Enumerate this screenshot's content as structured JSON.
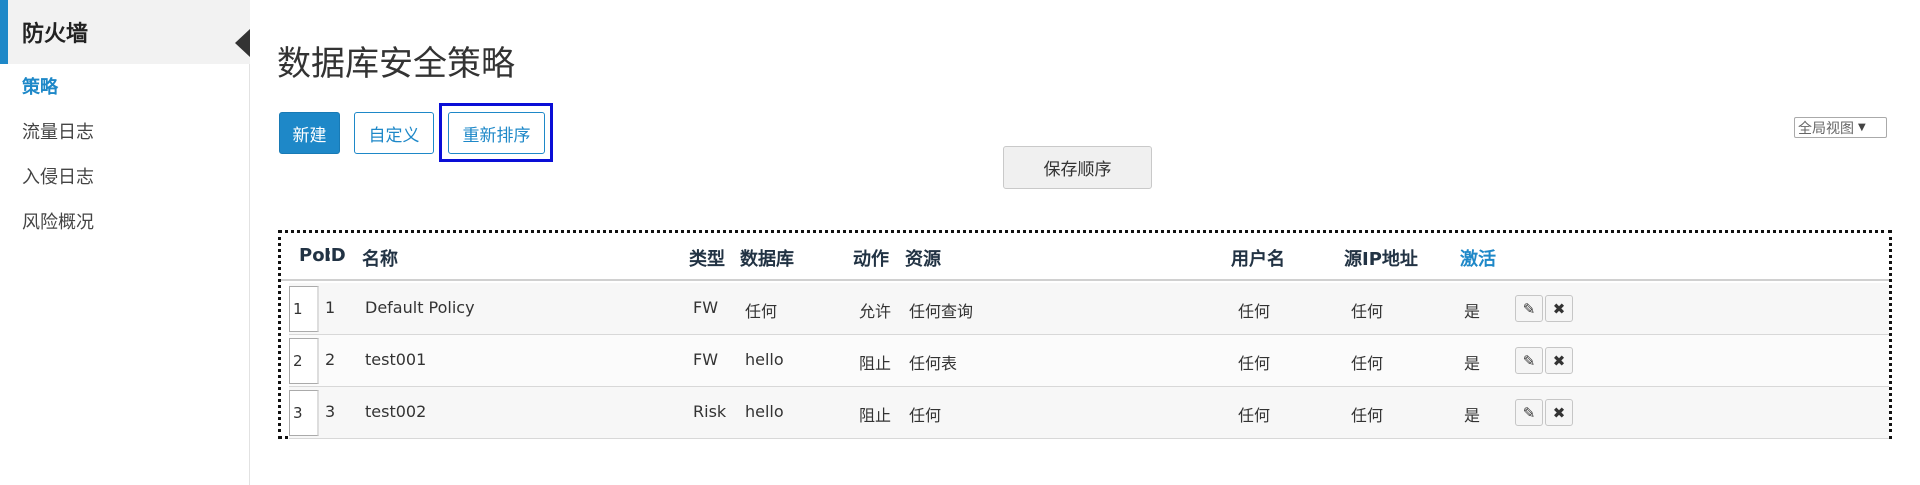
{
  "sidebar": {
    "title": "防火墙",
    "items": [
      {
        "label": "策略",
        "active": true
      },
      {
        "label": "流量日志",
        "active": false
      },
      {
        "label": "入侵日志",
        "active": false
      },
      {
        "label": "风险概况",
        "active": false
      }
    ]
  },
  "main": {
    "title": "数据库安全策略",
    "buttons": {
      "new": "新建",
      "custom": "自定义",
      "reorder": "重新排序",
      "save_order": "保存顺序"
    },
    "view_select": "全局视图"
  },
  "table": {
    "headers": {
      "pos": "Po:",
      "id": "ID",
      "name": "名称",
      "type": "类型",
      "database": "数据库",
      "action": "动作",
      "resource": "资源",
      "username": "用户名",
      "source_ip": "源IP地址",
      "active": "激活"
    },
    "rows": [
      {
        "pos": "1",
        "id": "1",
        "name": "Default Policy",
        "type": "FW",
        "database": "任何",
        "action": "允许",
        "resource": "任何查询",
        "username": "任何",
        "source_ip": "任何",
        "active": "是"
      },
      {
        "pos": "2",
        "id": "2",
        "name": "test001",
        "type": "FW",
        "database": "hello",
        "action": "阻止",
        "resource": "任何表",
        "username": "任何",
        "source_ip": "任何",
        "active": "是"
      },
      {
        "pos": "3",
        "id": "3",
        "name": "test002",
        "type": "Risk",
        "database": "hello",
        "action": "阻止",
        "resource": "任何",
        "username": "任何",
        "source_ip": "任何",
        "active": "是"
      }
    ]
  },
  "colors": {
    "accent": "#1e88c8",
    "highlight_frame": "#0a0ed6"
  }
}
